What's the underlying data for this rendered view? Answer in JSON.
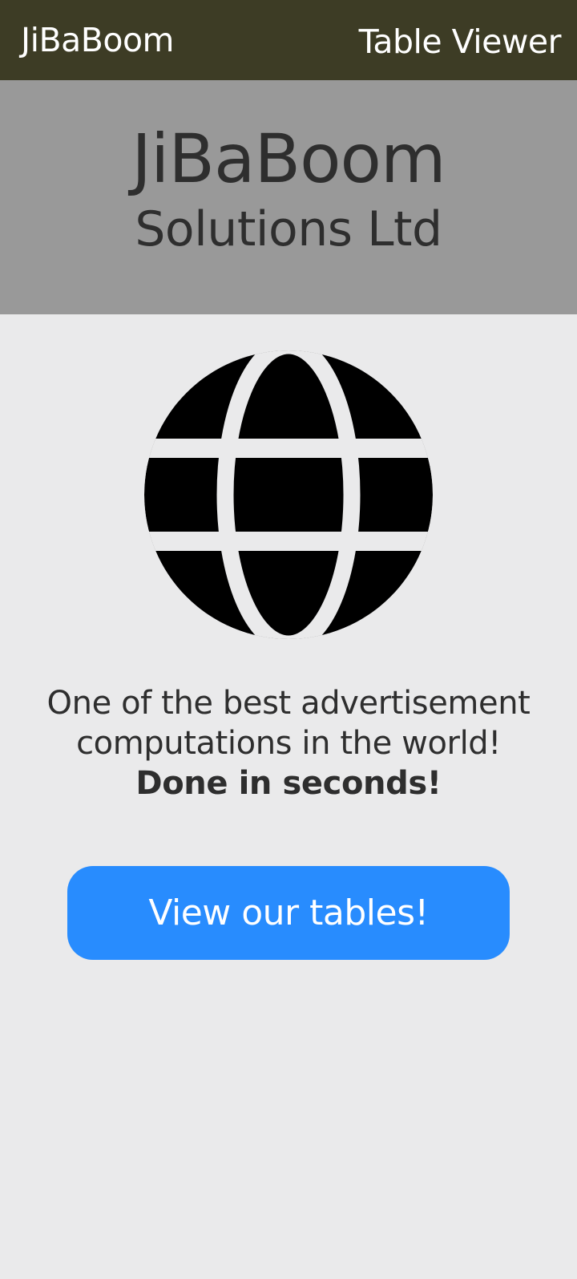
{
  "header": {
    "brand": "JiBaBoom",
    "page_title": "Table Viewer"
  },
  "hero": {
    "title": "JiBaBoom",
    "subtitle": "Solutions Ltd"
  },
  "main": {
    "icon": "globe-icon",
    "tagline_lines": [
      "One of the best advertisement",
      "computations in the world!",
      "Done in seconds!"
    ],
    "cta_label": "View our tables!"
  },
  "colors": {
    "header_bg": "#3d3c25",
    "hero_bg": "#999999",
    "page_bg": "#eaeaeb",
    "button_bg": "#288cfe",
    "text_dark": "#2e2e2e"
  }
}
